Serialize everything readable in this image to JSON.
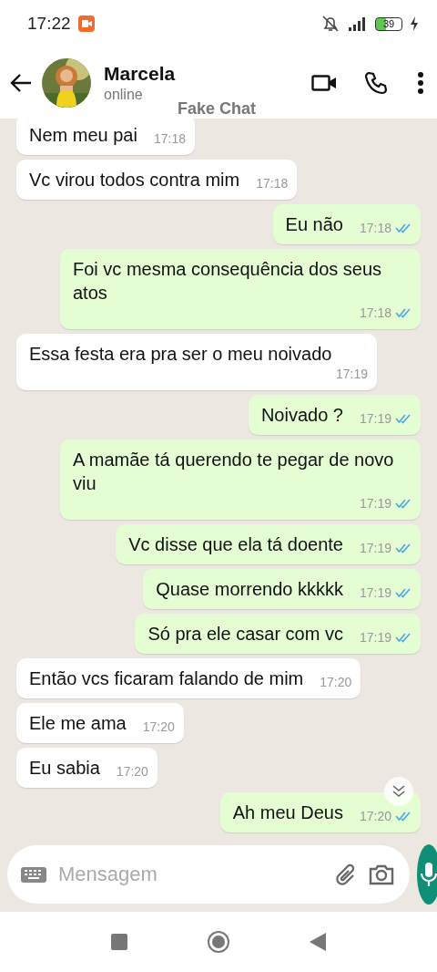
{
  "status_bar": {
    "time": "17:22",
    "battery": "39"
  },
  "header": {
    "name": "Marcela",
    "status": "online",
    "overlay_label": "Fake Chat"
  },
  "messages": [
    {
      "outgoing": false,
      "text": "Nem meu pai",
      "time": "17:18"
    },
    {
      "outgoing": false,
      "text": "Vc virou todos contra mim",
      "time": "17:18"
    },
    {
      "outgoing": true,
      "text": "Eu não",
      "time": "17:18",
      "read": true
    },
    {
      "outgoing": true,
      "text": "Foi vc mesma consequência dos seus atos",
      "time": "17:18",
      "read": true
    },
    {
      "outgoing": false,
      "text": "Essa festa era pra ser o meu noivado",
      "time": "17:19"
    },
    {
      "outgoing": true,
      "text": "Noivado ?",
      "time": "17:19",
      "read": true
    },
    {
      "outgoing": true,
      "text": "A mamãe tá querendo te pegar de novo viu",
      "time": "17:19",
      "read": true
    },
    {
      "outgoing": true,
      "text": "Vc disse que ela tá doente",
      "time": "17:19",
      "read": true
    },
    {
      "outgoing": true,
      "text": "Quase morrendo kkkkk",
      "time": "17:19",
      "read": true
    },
    {
      "outgoing": true,
      "text": "Só pra ele casar com vc",
      "time": "17:19",
      "read": true
    },
    {
      "outgoing": false,
      "text": "Então vcs ficaram falando de mim",
      "time": "17:20"
    },
    {
      "outgoing": false,
      "text": "Ele me ama",
      "time": "17:20"
    },
    {
      "outgoing": false,
      "text": "Eu sabia",
      "time": "17:20"
    },
    {
      "outgoing": true,
      "text": "Ah meu Deus",
      "time": "17:20",
      "read": true
    }
  ],
  "composer": {
    "placeholder": "Mensagem"
  }
}
